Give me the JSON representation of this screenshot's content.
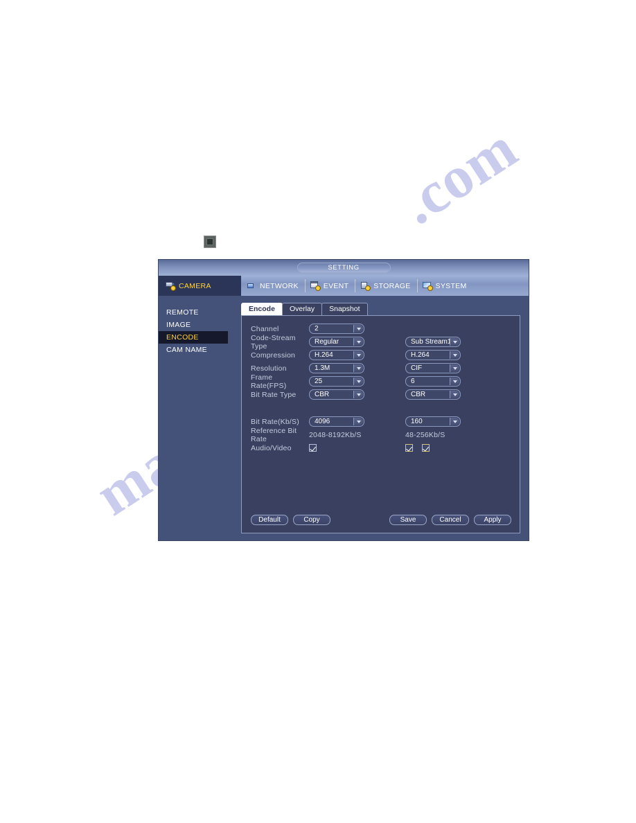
{
  "window": {
    "title": "SETTING"
  },
  "nav": {
    "items": [
      {
        "label": "CAMERA",
        "icon": "camera-icon",
        "active": true
      },
      {
        "label": "NETWORK",
        "icon": "network-icon",
        "active": false
      },
      {
        "label": "EVENT",
        "icon": "event-icon",
        "active": false
      },
      {
        "label": "STORAGE",
        "icon": "storage-icon",
        "active": false
      },
      {
        "label": "SYSTEM",
        "icon": "system-icon",
        "active": false
      }
    ]
  },
  "sidebar": {
    "items": [
      {
        "label": "REMOTE",
        "active": false
      },
      {
        "label": "IMAGE",
        "active": false
      },
      {
        "label": "ENCODE",
        "active": true
      },
      {
        "label": "CAM NAME",
        "active": false
      }
    ]
  },
  "tabs": [
    {
      "label": "Encode",
      "active": true
    },
    {
      "label": "Overlay",
      "active": false
    },
    {
      "label": "Snapshot",
      "active": false
    }
  ],
  "form": {
    "channel": {
      "label": "Channel",
      "main": "2"
    },
    "code_stream_type": {
      "label": "Code-Stream Type",
      "main": "Regular",
      "sub": "Sub Stream1"
    },
    "compression": {
      "label": "Compression",
      "main": "H.264",
      "sub": "H.264"
    },
    "resolution": {
      "label": "Resolution",
      "main": "1.3M",
      "sub": "CIF"
    },
    "frame_rate": {
      "label": "Frame Rate(FPS)",
      "main": "25",
      "sub": "6"
    },
    "bit_rate_type": {
      "label": "Bit Rate Type",
      "main": "CBR",
      "sub": "CBR"
    },
    "bit_rate": {
      "label": "Bit Rate(Kb/S)",
      "main": "4096",
      "sub": "160"
    },
    "reference_bit_rate": {
      "label": "Reference Bit Rate",
      "main": "2048-8192Kb/S",
      "sub": "48-256Kb/S"
    },
    "audio_video": {
      "label": "Audio/Video",
      "main_checked": true,
      "sub_checked_1": true,
      "sub_checked_2": true
    }
  },
  "buttons": {
    "default": "Default",
    "copy": "Copy",
    "save": "Save",
    "cancel": "Cancel",
    "apply": "Apply"
  },
  "watermark": {
    "line1": "manualmachine",
    "line2": ".com"
  },
  "colors": {
    "dialog_bg": "#445178",
    "panel_bg": "#3a4160",
    "active_nav_bg": "#2b3558",
    "accent_yellow": "#ffd33a",
    "sidebar_active_bg": "#16192c",
    "checkbox_border": "#d8c273"
  }
}
